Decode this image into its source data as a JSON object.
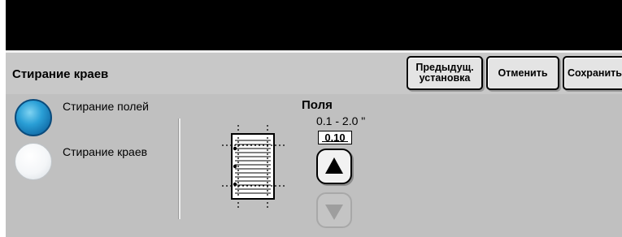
{
  "header": {
    "title": "Стирание краев",
    "buttons": {
      "previous": "Предыдущ.\nустановка",
      "cancel": "Отменить",
      "save": "Сохранить"
    }
  },
  "options": [
    {
      "label": "Стирание полей",
      "selected": true
    },
    {
      "label": "Стирание краев",
      "selected": false
    }
  ],
  "margins": {
    "title": "Поля",
    "range": "0.1 -  2.0 \"",
    "value": "0.10"
  },
  "icons": {
    "document": "document-margins-icon",
    "up": "arrow-up-icon",
    "down": "arrow-down-icon"
  },
  "colors": {
    "topbar": "#000000",
    "panel": "#c0c0c0",
    "radio_selected": "#2a9fd6",
    "radio_unselected": "#f4f6f8"
  }
}
